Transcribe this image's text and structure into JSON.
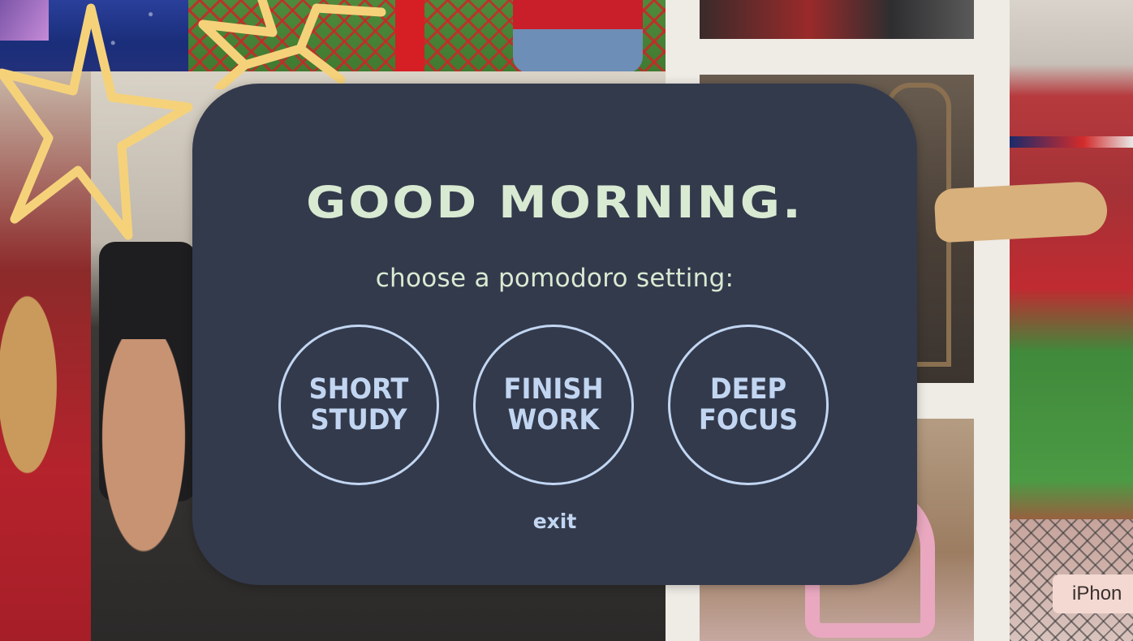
{
  "modal": {
    "greeting": "GOOD MORNING.",
    "subtitle": "choose a pomodoro setting:",
    "options": [
      {
        "label": "SHORT\nSTUDY"
      },
      {
        "label": "FINISH\nWORK"
      },
      {
        "label": "DEEP\nFOCUS"
      }
    ],
    "exit_label": "exit"
  },
  "background": {
    "chip_label": "iPhon",
    "icons": [
      "star-doodle-icon",
      "star-doodle-icon"
    ]
  },
  "colors": {
    "modal_bg": "#333a4c",
    "heading": "#d8ead2",
    "accent": "#c2d6f2",
    "star": "#f5d27a"
  }
}
